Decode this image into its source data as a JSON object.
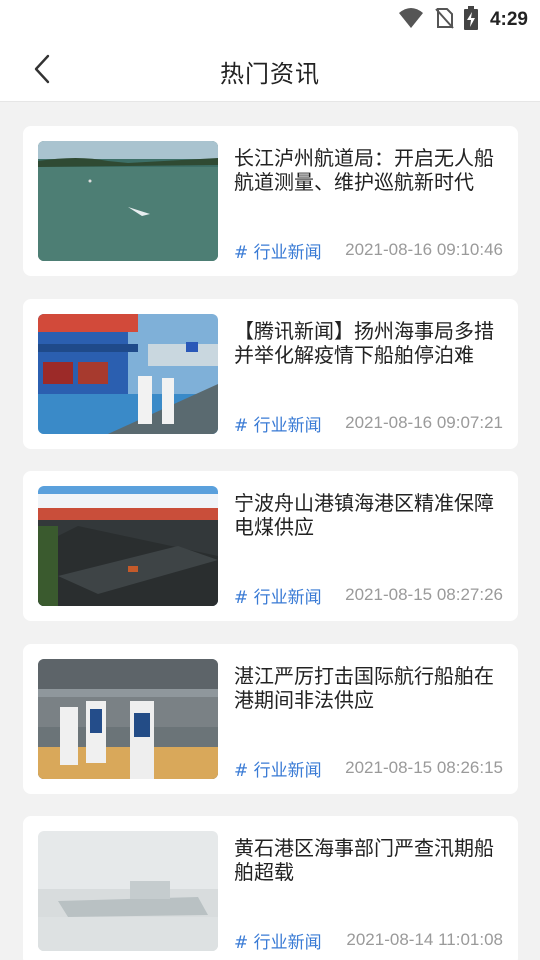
{
  "status_bar": {
    "time": "4:29",
    "icons": [
      "wifi-icon",
      "no-sim-icon",
      "battery-charging-icon"
    ]
  },
  "header": {
    "back_icon": "chevron-left-icon",
    "title": "热门资讯"
  },
  "news": [
    {
      "title": "长江泸州航道局：开启无人船航道测量、维护巡航新时代",
      "tag": "# 行业新闻",
      "time": "2021-08-16 09:10:46"
    },
    {
      "title": "【腾讯新闻】扬州海事局多措并举化解疫情下船舶停泊难",
      "tag": "# 行业新闻",
      "time": "2021-08-16 09:07:21"
    },
    {
      "title": "宁波舟山港镇海港区精准保障电煤供应",
      "tag": "# 行业新闻",
      "time": "2021-08-15 08:27:26"
    },
    {
      "title": "湛江严厉打击国际航行船舶在港期间非法供应",
      "tag": "# 行业新闻",
      "time": "2021-08-15 08:26:15"
    },
    {
      "title": "黄石港区海事部门严查汛期船舶超载",
      "tag": "# 行业新闻",
      "time": "2021-08-14 11:01:08"
    }
  ]
}
